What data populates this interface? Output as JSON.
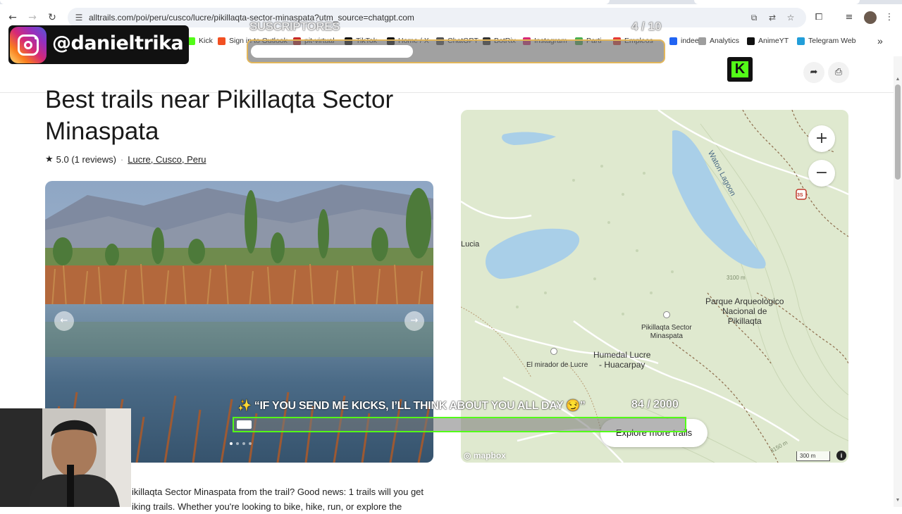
{
  "browser": {
    "url": "alltrails.com/poi/peru/cusco/lucre/pikillaqta-sector-minaspata?utm_source=chatgpt.com",
    "bookmarks": [
      {
        "label": "Kick",
        "color": "#53fc18"
      },
      {
        "label": "Sign in to Outlook",
        "color": "#f25022"
      },
      {
        "label": "pit-virtual",
        "color": "#c62828"
      },
      {
        "label": "TikTok",
        "color": "#111111"
      },
      {
        "label": "Home / X",
        "color": "#111111"
      },
      {
        "label": "ChatGPT",
        "color": "#555555"
      },
      {
        "label": "BotRix",
        "color": "#333333"
      },
      {
        "label": "Instagram",
        "color": "#d62976"
      },
      {
        "label": "Parti",
        "color": "#4caf50"
      },
      {
        "label": "Empleos",
        "color": "#e53935"
      },
      {
        "label": "indeed",
        "color": "#2164f3"
      },
      {
        "label": "Analytics",
        "color": "#9e9e9e"
      },
      {
        "label": "AnimeYT",
        "color": "#111111"
      },
      {
        "label": "Telegram Web",
        "color": "#229ed9"
      }
    ],
    "more_bookmarks": "»"
  },
  "page": {
    "title": "Best trails near Pikillaqta Sector Minaspata",
    "rating": "5.0 (1 reviews)",
    "location": "Lucre, Cusco, Peru",
    "body_line1": "ikillaqta Sector Minaspata from the trail? Good news: 1 trails will you get",
    "body_line2": "iking trails. Whether you're looking to bike, hike, run, or explore the"
  },
  "map": {
    "labels": {
      "waton": "Waton Lagoon",
      "lucia": "Lucia",
      "parque": "Parque Arqueológico\nNacional de\nPikillaqta",
      "sector": "Pikillaqta Sector\nMinaspata",
      "humedal": "Humedal Lucre\n- Huacarpay",
      "mirador": "El mirador de Lucre",
      "route": "3S",
      "contour1": "3100 m",
      "contour2": "3150 m"
    },
    "explore_label": "Explore more trails",
    "attribution": "mapbox",
    "scale_label": "300 m",
    "zoom_in": "+",
    "zoom_out": "−"
  },
  "overlays": {
    "instagram_handle": "@danieltrika",
    "subs_label": "SUSCRIPTORES",
    "subs_count": "4 / 10",
    "subs_progress": 0.4,
    "kick_goal_text": "✨ “IF YOU SEND ME KICKS, I’LL THINK ABOUT YOU ALL DAY 😏”",
    "kick_count": "84 / 2000",
    "kick_progress": 0.042
  },
  "colors": {
    "accent_kick": "#53fc18",
    "map_bg": "#dfe9cf",
    "water": "#a9cfe8",
    "sub_border": "#e2b65a"
  }
}
